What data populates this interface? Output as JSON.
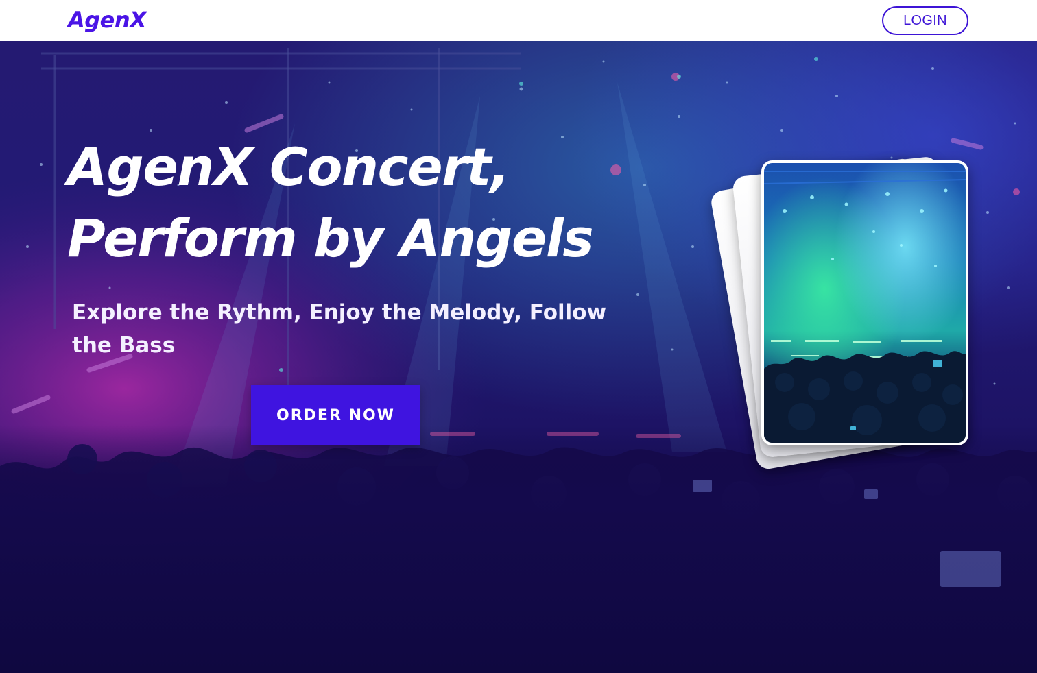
{
  "nav": {
    "brand": "AgenX",
    "login_label": "LOGIN"
  },
  "hero": {
    "title_line1": "AgenX Concert,",
    "title_line2": "Perform by Angels",
    "subtitle": "Explore the Rythm, Enjoy the Melody, Follow  the Bass",
    "cta_label": "ORDER NOW"
  },
  "colors": {
    "brand": "#4a14e6",
    "cta_background": "#3f14e0",
    "hero_overlay": "#1a0e55"
  }
}
